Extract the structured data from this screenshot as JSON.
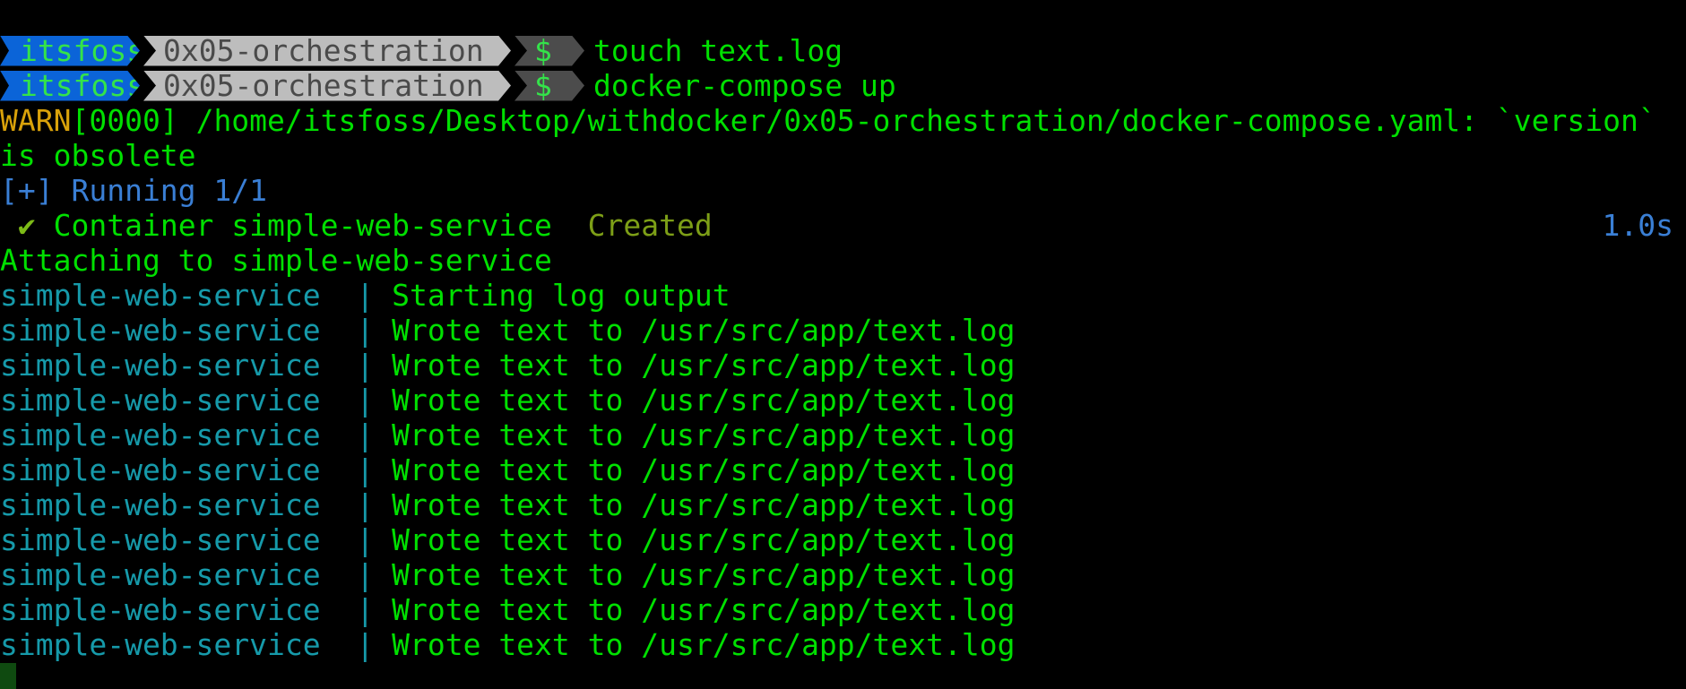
{
  "prompt": {
    "user": "itsfoss",
    "directory": "0x05-orchestration",
    "symbol": "$"
  },
  "commands": [
    "touch text.log",
    "docker-compose up"
  ],
  "warning": {
    "label": "WARN",
    "code": "[0000]",
    "message": " /home/itsfoss/Desktop/withdocker/0x05-orchestration/docker-compose.yaml: `version`",
    "continuation": "is obsolete"
  },
  "running": "[+] Running 1/1",
  "container": {
    "check": " ✔",
    "label": " Container simple-web-service  ",
    "status": "Created",
    "duration": "1.0s"
  },
  "attaching": "Attaching to simple-web-service",
  "logs": [
    {
      "service": "simple-web-service",
      "sep": "  | ",
      "text": "Starting log output"
    },
    {
      "service": "simple-web-service",
      "sep": "  | ",
      "text": "Wrote text to /usr/src/app/text.log"
    },
    {
      "service": "simple-web-service",
      "sep": "  | ",
      "text": "Wrote text to /usr/src/app/text.log"
    },
    {
      "service": "simple-web-service",
      "sep": "  | ",
      "text": "Wrote text to /usr/src/app/text.log"
    },
    {
      "service": "simple-web-service",
      "sep": "  | ",
      "text": "Wrote text to /usr/src/app/text.log"
    },
    {
      "service": "simple-web-service",
      "sep": "  | ",
      "text": "Wrote text to /usr/src/app/text.log"
    },
    {
      "service": "simple-web-service",
      "sep": "  | ",
      "text": "Wrote text to /usr/src/app/text.log"
    },
    {
      "service": "simple-web-service",
      "sep": "  | ",
      "text": "Wrote text to /usr/src/app/text.log"
    },
    {
      "service": "simple-web-service",
      "sep": "  | ",
      "text": "Wrote text to /usr/src/app/text.log"
    },
    {
      "service": "simple-web-service",
      "sep": "  | ",
      "text": "Wrote text to /usr/src/app/text.log"
    },
    {
      "service": "simple-web-service",
      "sep": "  | ",
      "text": "Wrote text to /usr/src/app/text.log"
    }
  ],
  "colors": {
    "background": "#000000",
    "green": "#00e000",
    "user_segment": "#0b64d8",
    "dir_segment": "#bdbdbd",
    "symbol_segment": "#4c4c4c",
    "warn": "#d9a20a",
    "blue": "#3a7fd5",
    "cyan": "#169aaa"
  }
}
